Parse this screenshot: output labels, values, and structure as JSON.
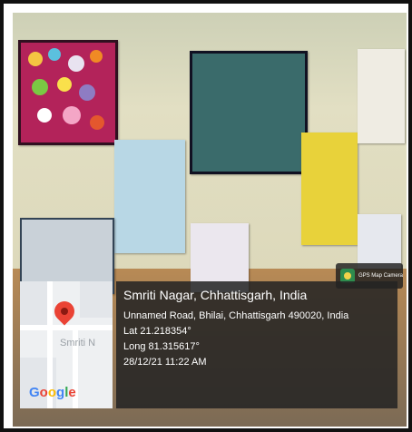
{
  "gps_badge": {
    "label": "GPS Map Camera",
    "icon": "gps-map-camera-icon"
  },
  "map": {
    "street_label": "Smriti N",
    "logo": {
      "letters": [
        "G",
        "o",
        "o",
        "g",
        "l",
        "e"
      ],
      "colors": [
        "#4285f4",
        "#ea4335",
        "#fbbc05",
        "#4285f4",
        "#34a853",
        "#ea4335"
      ]
    },
    "pin_icon": "location-pin-icon"
  },
  "location": {
    "title": "Smriti Nagar, Chhattisgarh, India",
    "address": "Unnamed Road, Bhilai, Chhattisgarh 490020, India",
    "latitude": "Lat 21.218354°",
    "longitude": "Long 81.315617°",
    "datetime": "28/12/21 11:22 AM"
  }
}
